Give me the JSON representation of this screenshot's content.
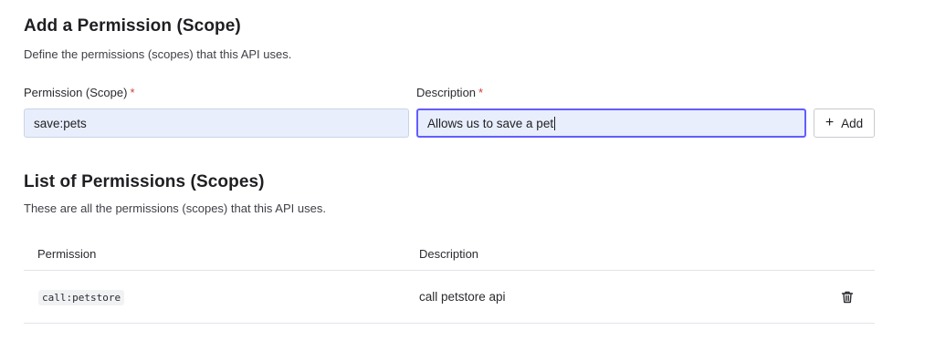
{
  "add_section": {
    "title": "Add a Permission (Scope)",
    "subtitle": "Define the permissions (scopes) that this API uses.",
    "scope_label": "Permission (Scope)",
    "description_label": "Description",
    "required_marker": "*",
    "scope_value": "save:pets",
    "description_value": "Allows us to save a pet",
    "add_button_label": "Add"
  },
  "list_section": {
    "title": "List of Permissions (Scopes)",
    "subtitle": "These are all the permissions (scopes) that this API uses.",
    "columns": [
      "Permission",
      "Description"
    ],
    "rows": [
      {
        "permission": "call:petstore",
        "description": "call petstore api",
        "action_icon": "trash-icon"
      }
    ]
  },
  "colors": {
    "accent": "#635dff",
    "input_bg": "#e8eefb",
    "required": "#d03c38"
  }
}
